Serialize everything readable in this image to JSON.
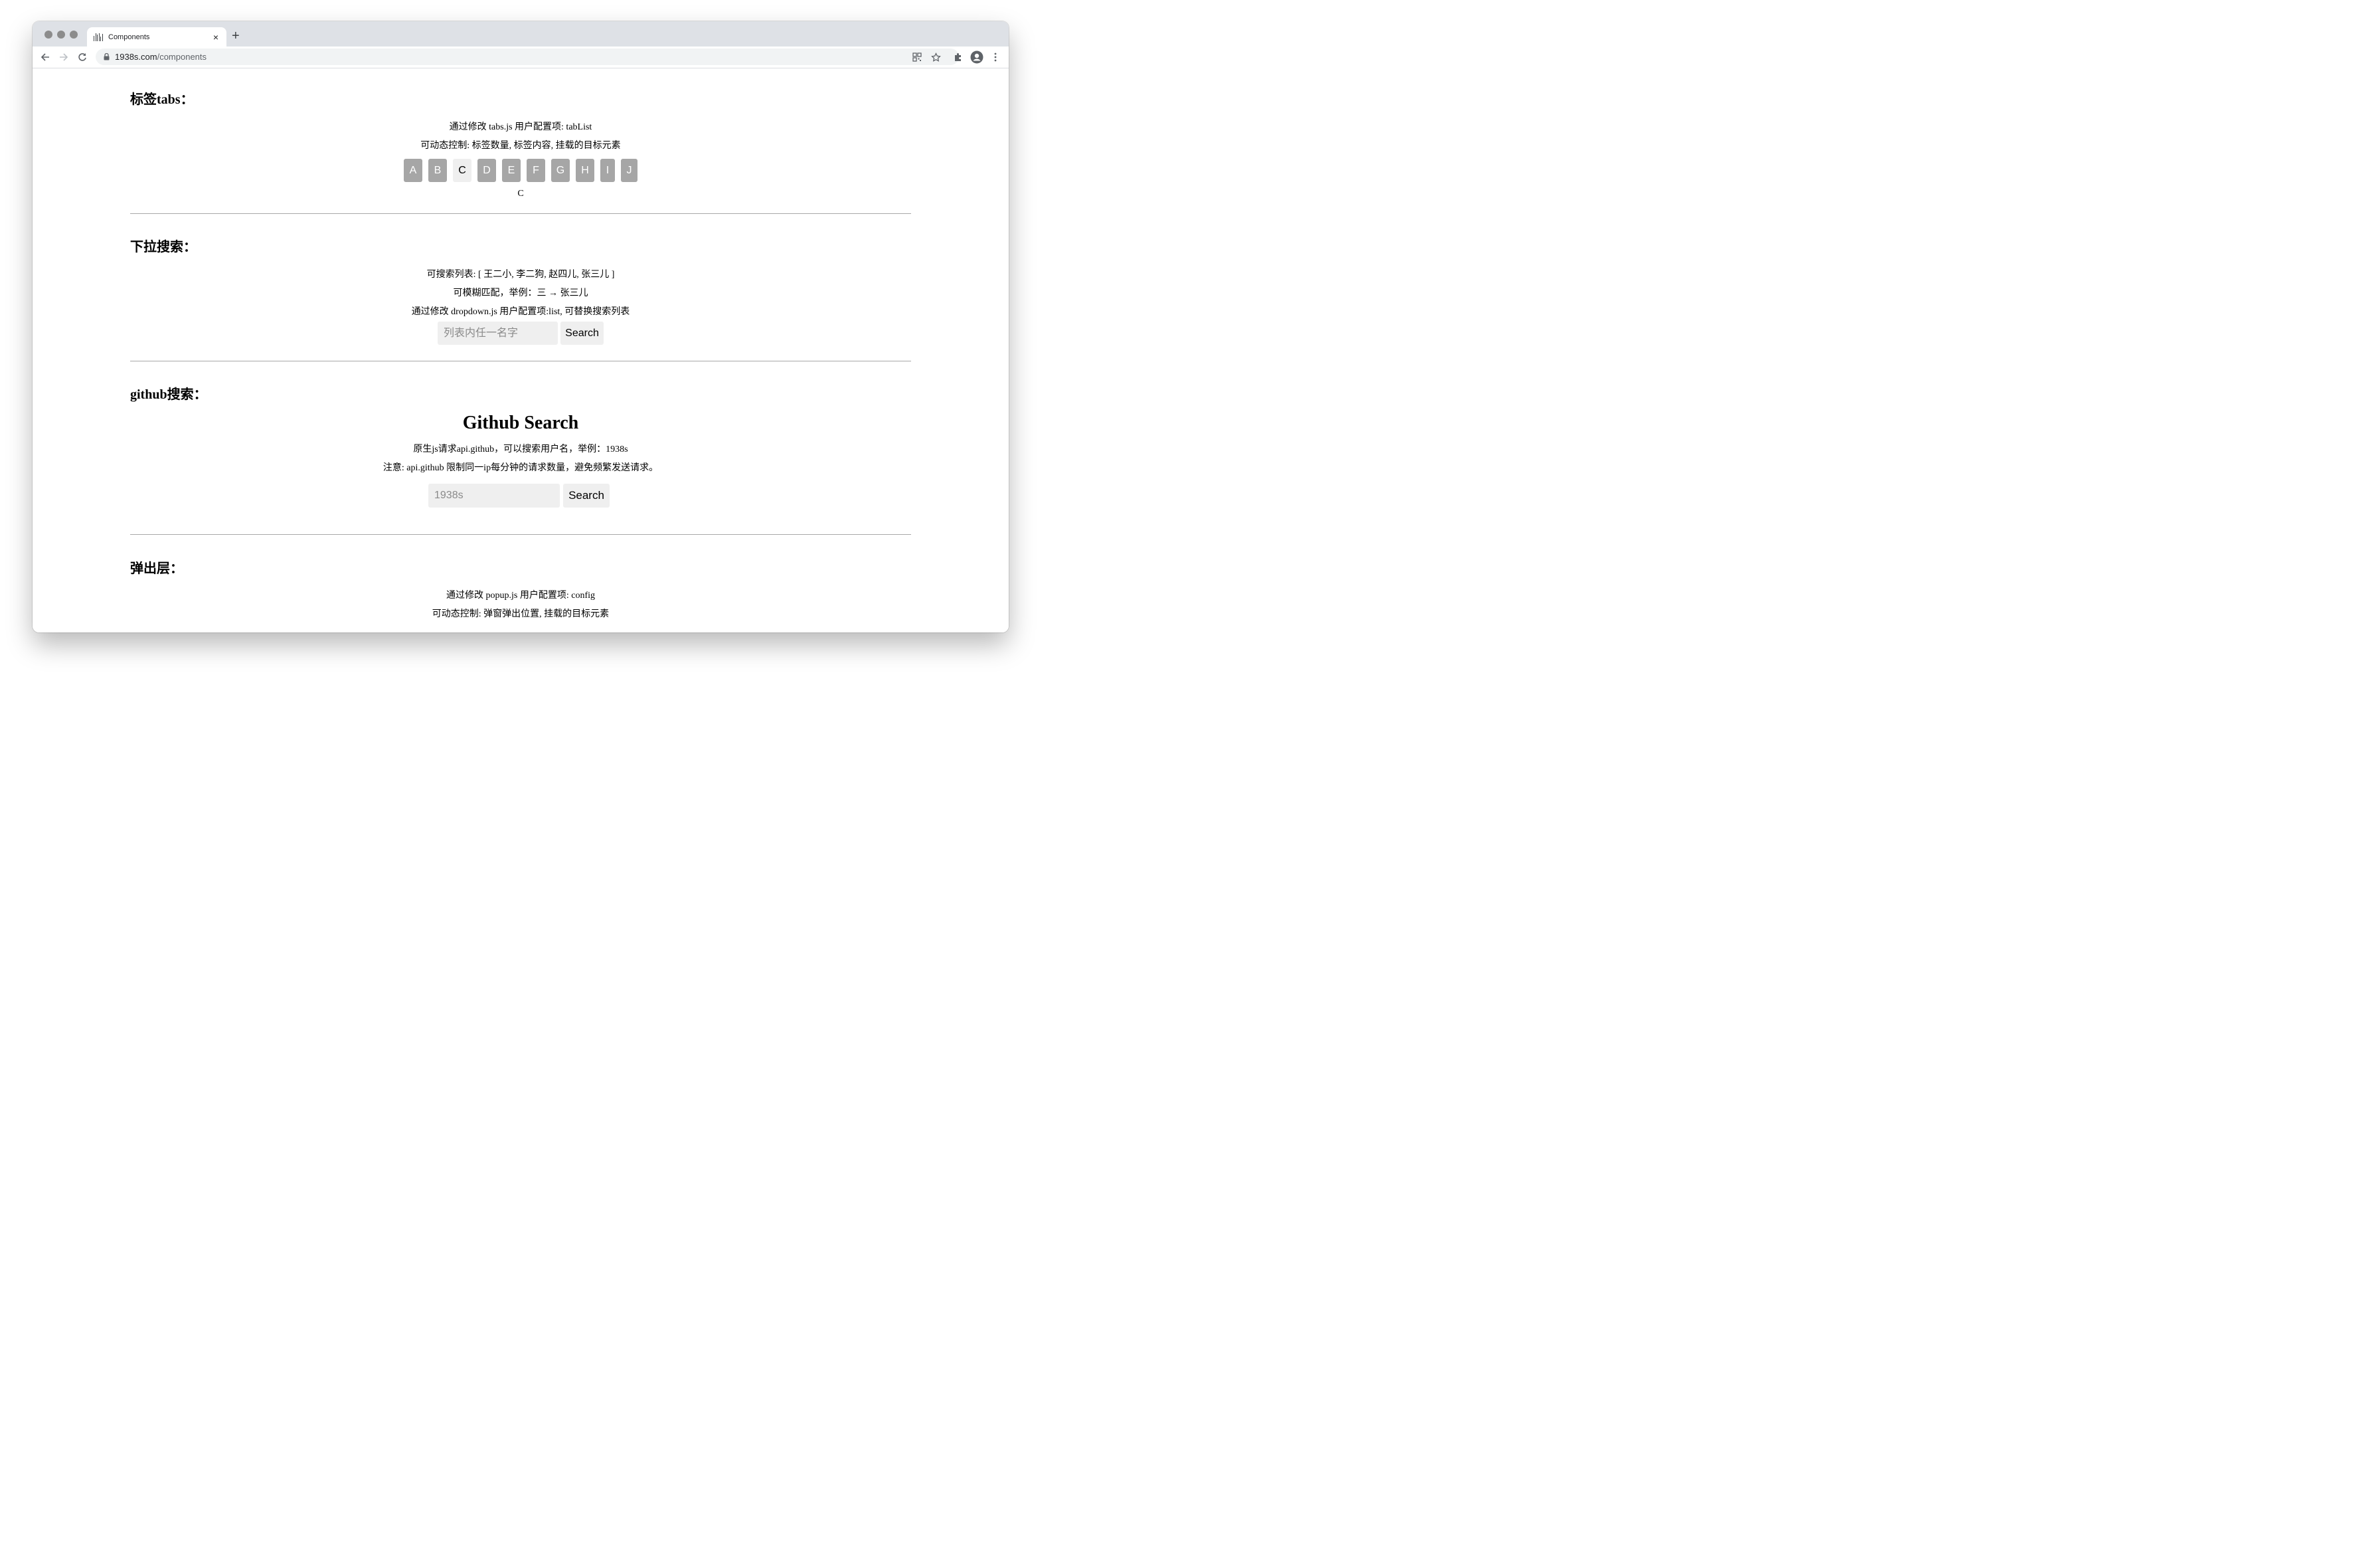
{
  "browser": {
    "tab_title": "Components",
    "tab_close": "×",
    "new_tab": "+",
    "url_host": "1938s.com",
    "url_path": "/components"
  },
  "icons": {
    "back": "back-arrow-icon",
    "forward": "forward-arrow-icon",
    "reload": "reload-icon",
    "lock": "lock-icon",
    "qr": "qr-code-icon",
    "star": "bookmark-star-icon",
    "extensions": "puzzle-icon",
    "profile": "profile-avatar-icon",
    "menu": "kebab-menu-icon"
  },
  "colors": {
    "tab_strip": "#dee1e6",
    "tab_button": "#a6a6a6",
    "tab_button_active": "#efefef",
    "input_bg": "#efefef",
    "divider": "#a8a8a8"
  },
  "tabs_section": {
    "title": "标签tabs：",
    "desc1": "通过修改 tabs.js 用户配置项: tabList",
    "desc2": "可动态控制: 标签数量, 标签内容, 挂载的目标元素",
    "buttons": [
      "A",
      "B",
      "C",
      "D",
      "E",
      "F",
      "G",
      "H",
      "I",
      "J"
    ],
    "active_index": 2,
    "active_content": "C"
  },
  "dropdown_section": {
    "title": "下拉搜索：",
    "desc1": "可搜索列表: [ 王二小, 李二狗, 赵四儿, 张三儿 ]",
    "desc2": "可模糊匹配，举例：三 → 张三儿",
    "desc3": "通过修改 dropdown.js 用户配置项:list, 可替换搜索列表",
    "placeholder": "列表内任一名字",
    "button": "Search"
  },
  "github_section": {
    "title": "github搜索：",
    "heading": "Github Search",
    "desc1": "原生js请求api.github，可以搜索用户名，举例：1938s",
    "desc2": "注意: api.github 限制同一ip每分钟的请求数量，避免频繁发送请求。",
    "placeholder": "1938s",
    "button": "Search"
  },
  "popup_section": {
    "title": "弹出层：",
    "desc1": "通过修改 popup.js 用户配置项: config",
    "desc2": "可动态控制: 弹窗弹出位置, 挂载的目标元素"
  }
}
